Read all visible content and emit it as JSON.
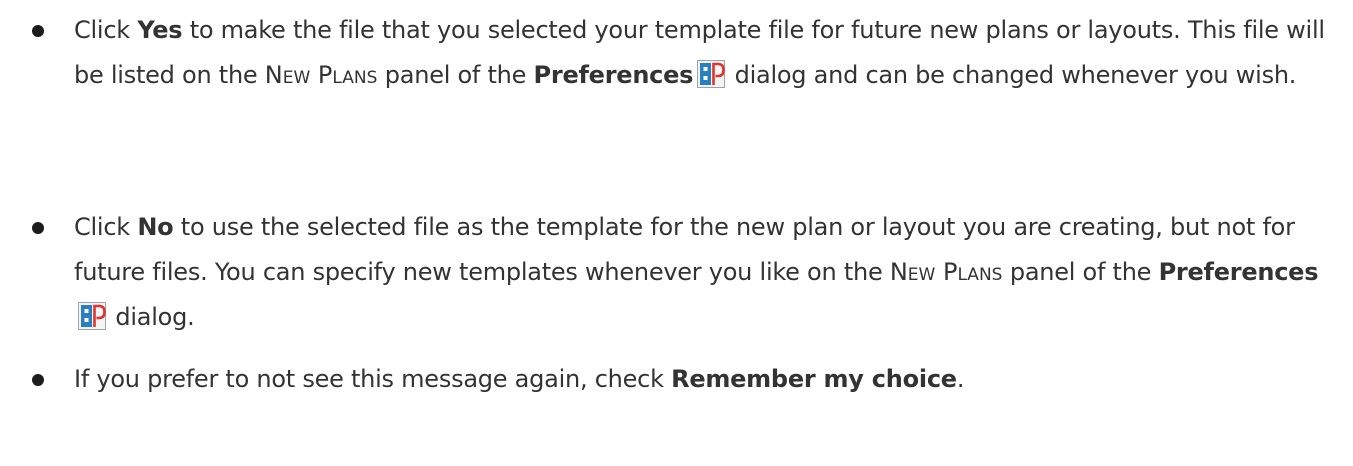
{
  "items": [
    {
      "p1": "Click ",
      "b1": "Yes",
      "p2": " to make the file that you selected your template file for future new plans or layouts. This file will be listed on the ",
      "sc1": "New Plans",
      "p3": " panel of the ",
      "b2": "Preferences",
      "p4": " dialog and can be changed whenever you wish."
    },
    {
      "p1": "Click ",
      "b1": "No",
      "p2": " to use the selected file as the template for the new plan or layout you are creating, but not for future files. You can specify new templates whenever you like on the ",
      "sc1": "New Plans",
      "p3": " panel of the ",
      "b2": "Preferences",
      "p4": " dialog."
    },
    {
      "p1": "If you prefer to not see this message again, check ",
      "b1": "Remember my choice",
      "p2": "."
    }
  ],
  "icons": {
    "preferences": "preferences-icon"
  },
  "colors": {
    "text": "#333333",
    "icon_blue": "#2a7fc0",
    "icon_red": "#e0342c"
  }
}
